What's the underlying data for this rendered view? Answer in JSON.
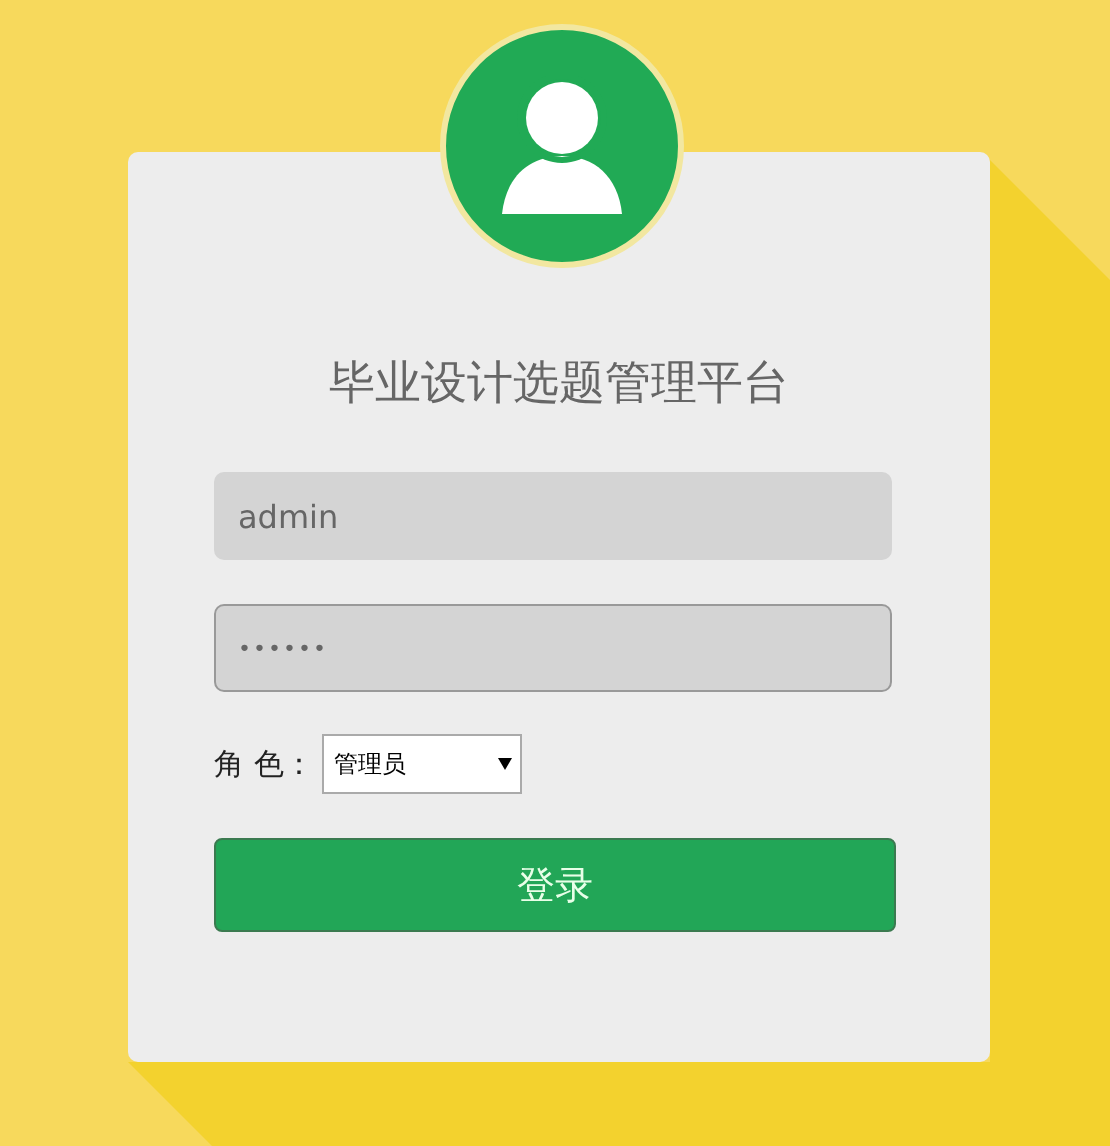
{
  "title": "毕业设计选题管理平台",
  "username": {
    "value": "admin"
  },
  "password": {
    "value": "••••••"
  },
  "role": {
    "label": "角 色：",
    "value": "管理员"
  },
  "login_button": {
    "label": "登录"
  }
}
